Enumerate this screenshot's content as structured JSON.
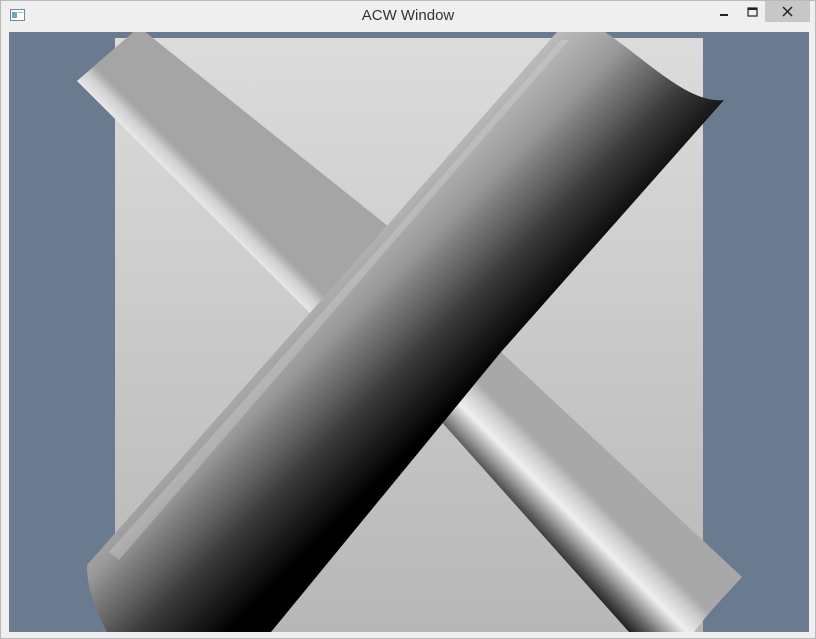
{
  "window": {
    "title": "ACW Window"
  },
  "titlebar_buttons": {
    "minimize_icon": "minimize-icon",
    "maximize_icon": "maximize-icon",
    "close_icon": "close-icon"
  },
  "colors": {
    "viewport_background": "#6b7b8f",
    "panel_top": "#dedede",
    "panel_bottom": "#b8b8b8"
  }
}
